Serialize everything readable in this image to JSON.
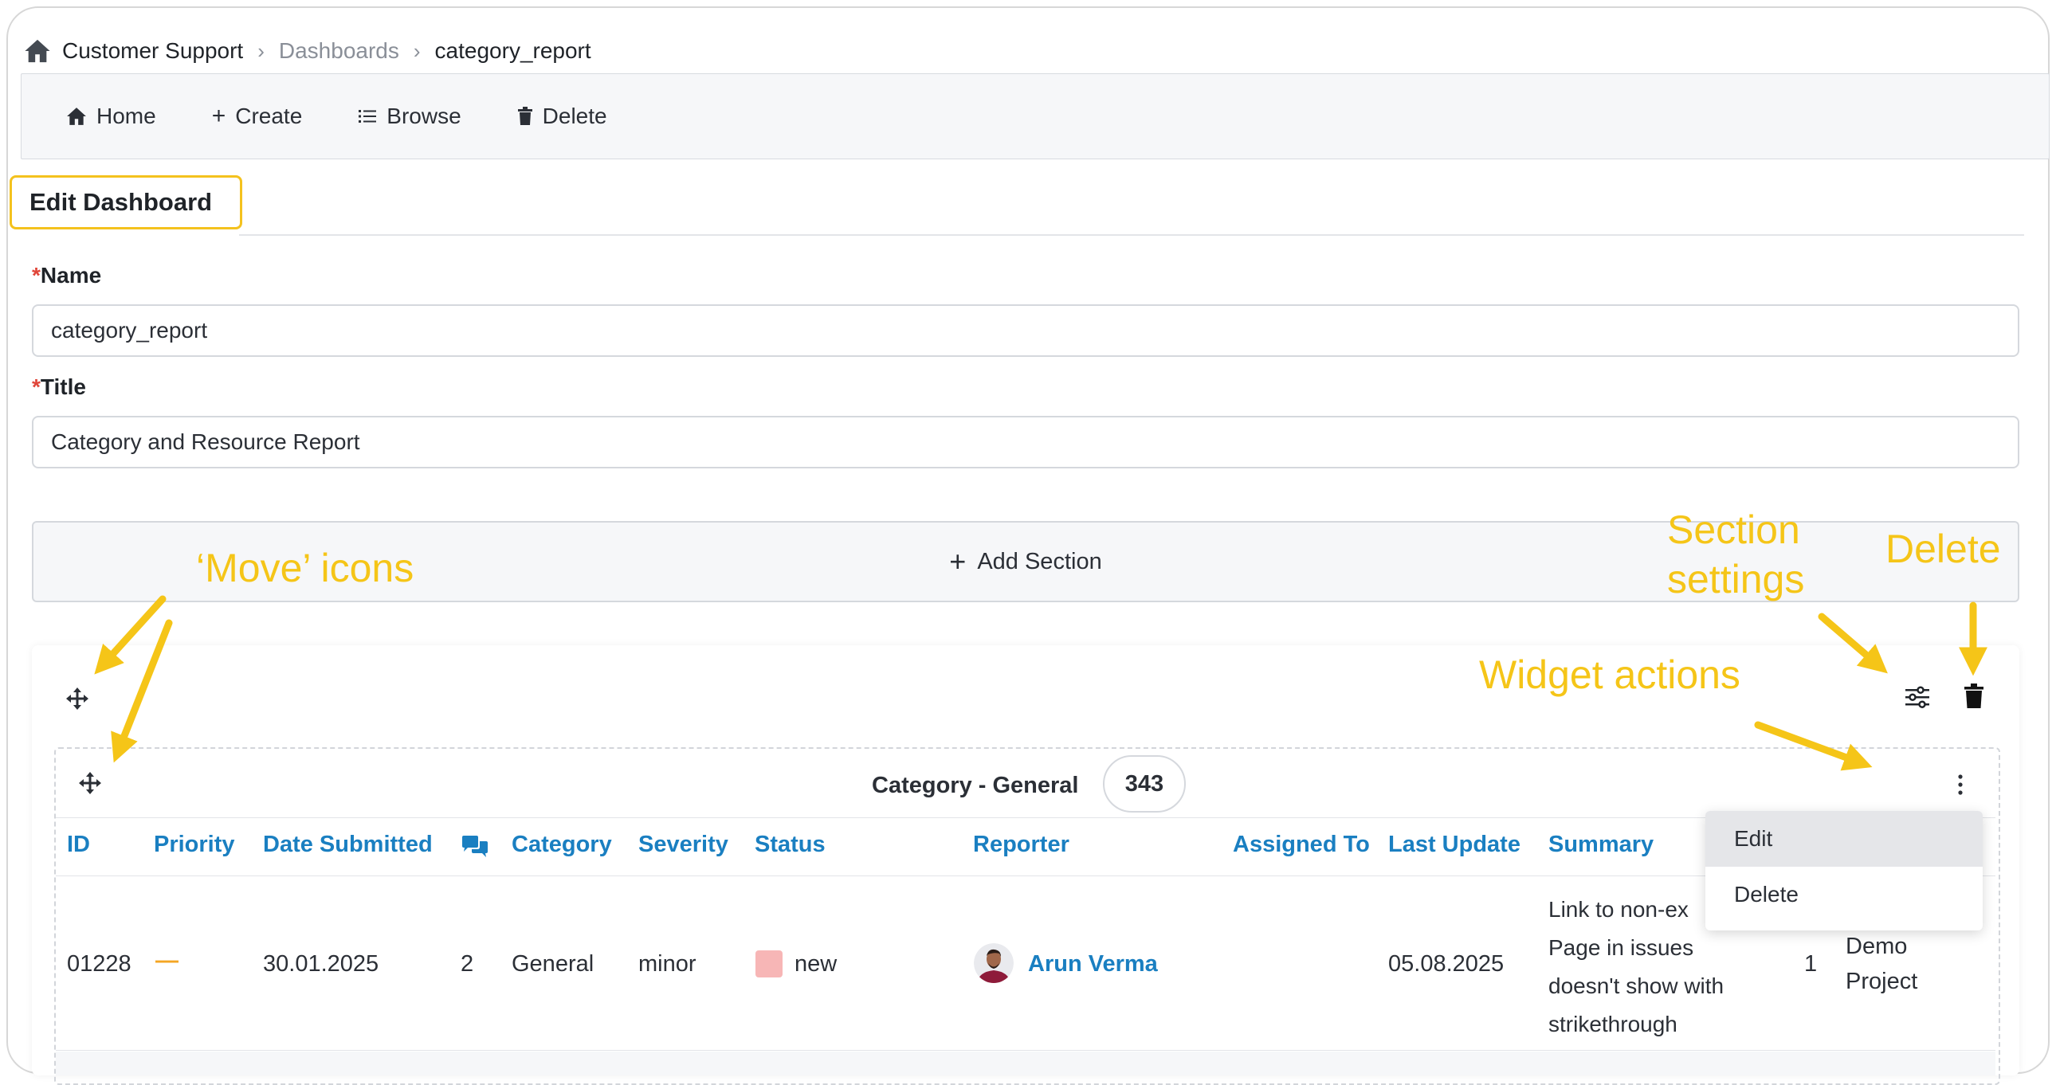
{
  "breadcrumb": {
    "root": "Customer Support",
    "middle": "Dashboards",
    "current": "category_report"
  },
  "nav": {
    "home": "Home",
    "create": "Create",
    "browse": "Browse",
    "delete": "Delete"
  },
  "tab": {
    "label": "Edit Dashboard"
  },
  "form": {
    "name_label": "Name",
    "name_value": "category_report",
    "title_label": "Title",
    "title_value": "Category and Resource Report",
    "required_marker": "*"
  },
  "add_section": {
    "label": "Add Section"
  },
  "widget": {
    "title": "Category - General",
    "count": "343"
  },
  "table": {
    "headers": [
      "ID",
      "Priority",
      "Date Submitted",
      "Category",
      "Severity",
      "Status",
      "Reporter",
      "Assigned To",
      "Last Update",
      "Summary"
    ],
    "row": {
      "id": "01228",
      "priority": "—",
      "date_submitted": "30.01.2025",
      "notes": "2",
      "category": "General",
      "severity": "minor",
      "status": "new",
      "reporter": "Arun Verma",
      "last_update": "05.08.2025",
      "summary_lines": [
        "Link to non-ex",
        "Page in issues",
        "doesn't show with",
        "strikethrough"
      ],
      "extra_num": "1",
      "project_lines": [
        "Demo",
        "Project"
      ]
    }
  },
  "menu": {
    "items": [
      "Edit",
      "Delete"
    ]
  },
  "annotations": {
    "move": "‘Move’ icons",
    "section_settings_1": "Section",
    "section_settings_2": "settings",
    "delete": "Delete",
    "widget_actions": "Widget actions"
  },
  "colors": {
    "accent": "#1a7fc1",
    "annotation": "#f5c518",
    "required": "#e0463a",
    "status_new": "#f7b6b6"
  },
  "icons": [
    "home-icon",
    "plus-icon",
    "list-icon",
    "trash-icon",
    "move-icon",
    "sliders-icon",
    "kebab-icon",
    "comments-icon"
  ]
}
